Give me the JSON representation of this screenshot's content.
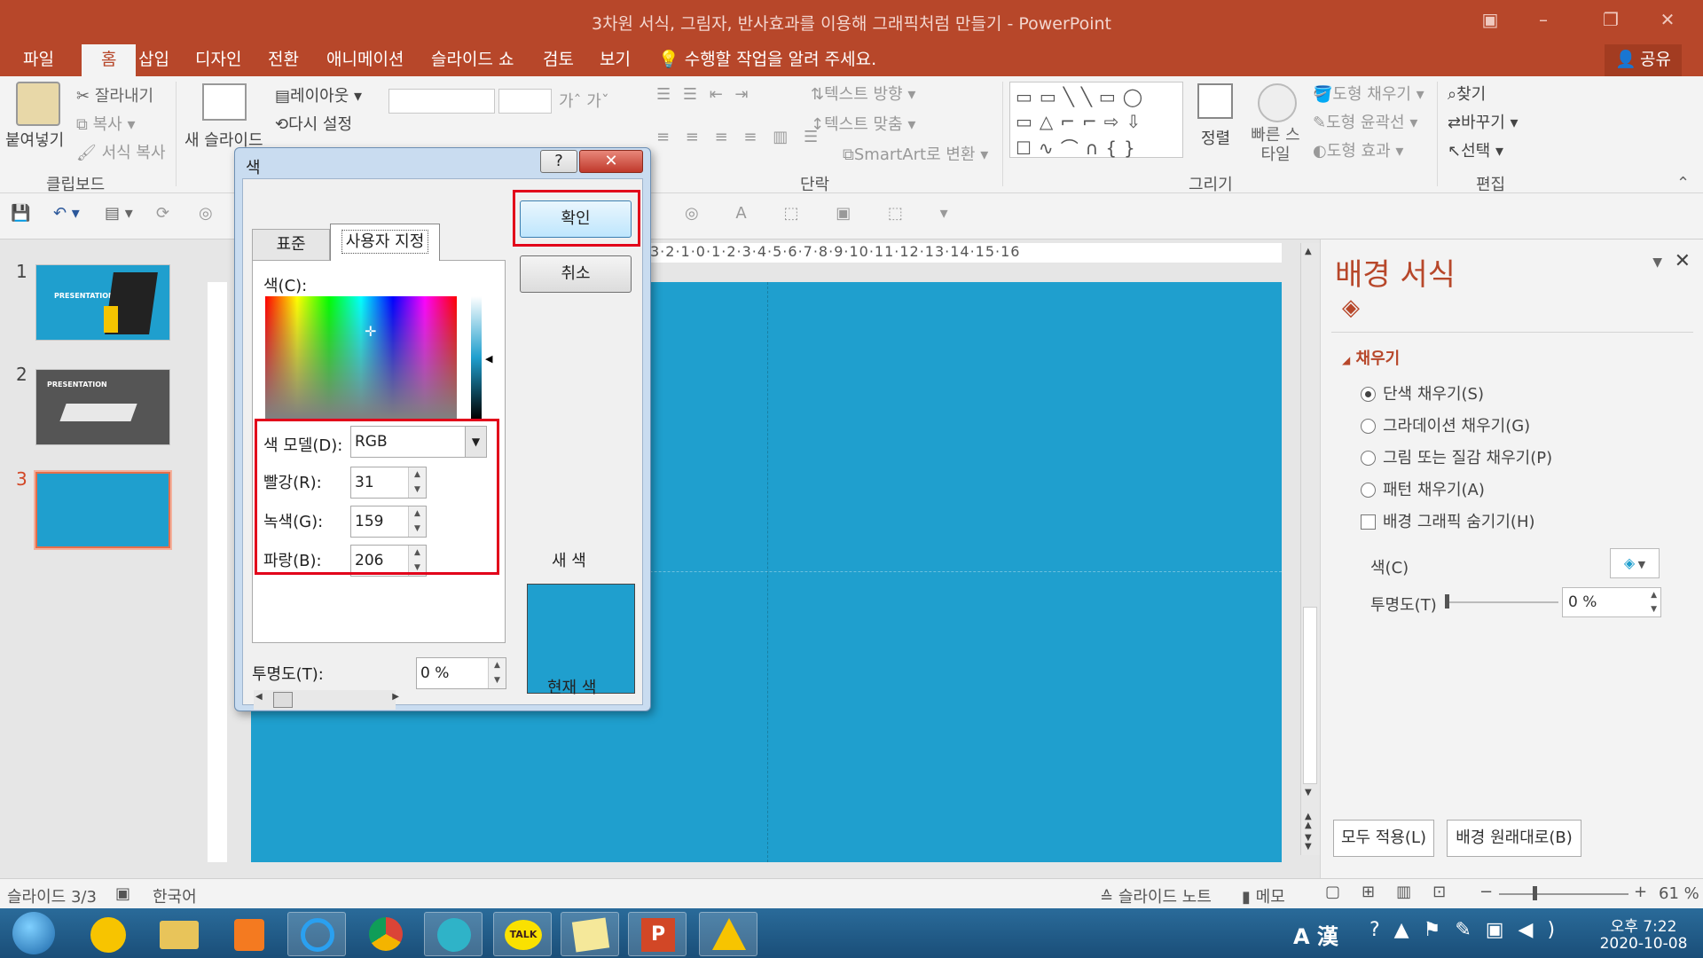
{
  "window": {
    "title": "3차원 서식, 그림자, 반사효과를 이용해 그래픽처럼 만들기 - PowerPoint"
  },
  "menu": {
    "tabs": [
      "파일",
      "홈",
      "삽입",
      "디자인",
      "전환",
      "애니메이션",
      "슬라이드 쇼",
      "검토",
      "보기"
    ],
    "tell_me": "수행할 작업을 알려 주세요.",
    "share": "공유"
  },
  "ribbon": {
    "paste": "붙여넣기",
    "cut": "잘라내기",
    "copy": "복사",
    "format_painter": "서식 복사",
    "clipboard_group": "클립보드",
    "new_slide": "새 슬라이드",
    "layout": "레이아웃",
    "reset": "다시 설정",
    "paragraph_group": "단락",
    "text_direction": "텍스트 방향",
    "align_text": "텍스트 맞춤",
    "smartart": "SmartArt로 변환",
    "arrange": "정렬",
    "quick_styles": "빠른 스타일",
    "shape_fill": "도형 채우기",
    "shape_outline": "도형 윤곽선",
    "shape_effects": "도형 효과",
    "drawing_group": "그리기",
    "find": "찾기",
    "replace": "바꾸기",
    "select": "선택",
    "editing_group": "편집"
  },
  "thumbnails": [
    {
      "num": "1",
      "text": "PRESENTATION"
    },
    {
      "num": "2",
      "text": "PRESENTATION"
    },
    {
      "num": "3",
      "text": ""
    }
  ],
  "ruler": {
    "h": "3·2·1·0·1·2·3·4·5·6·7·8·9·10·11·12·13·14·15·16"
  },
  "pane": {
    "title": "배경 서식",
    "section": "채우기",
    "options": [
      "단색 채우기(S)",
      "그라데이션 채우기(G)",
      "그림 또는 질감 채우기(P)",
      "패턴 채우기(A)"
    ],
    "hide_bg": "배경 그래픽 숨기기(H)",
    "color_label": "색(C)",
    "transparency_label": "투명도(T)",
    "transparency_value": "0 %",
    "apply_all": "모두 적용(L)",
    "reset_bg": "배경 원래대로(B)"
  },
  "dialog": {
    "title": "색",
    "help": "?",
    "tab_standard": "표준",
    "tab_custom": "사용자 지정",
    "ok": "확인",
    "cancel": "취소",
    "colors_label": "색(C):",
    "model_label": "색 모델(D):",
    "model_value": "RGB",
    "red_label": "빨강(R):",
    "red_value": "31",
    "green_label": "녹색(G):",
    "green_value": "159",
    "blue_label": "파랑(B):",
    "blue_value": "206",
    "new_label": "새 색",
    "current_label": "현재 색",
    "transparency_label": "투명도(T):",
    "transparency_value": "0 %"
  },
  "status": {
    "slide": "슬라이드 3/3",
    "lang": "한국어",
    "notes": "슬라이드 노트",
    "comments": "메모",
    "zoom": "61 %"
  },
  "taskbar": {
    "time": "오후 7:22",
    "date": "2020-10-08",
    "ime": "A 漢"
  },
  "colors": {
    "accent": "#b7472a",
    "slide_bg": "#1f9fce",
    "highlight": "#e2001a"
  }
}
